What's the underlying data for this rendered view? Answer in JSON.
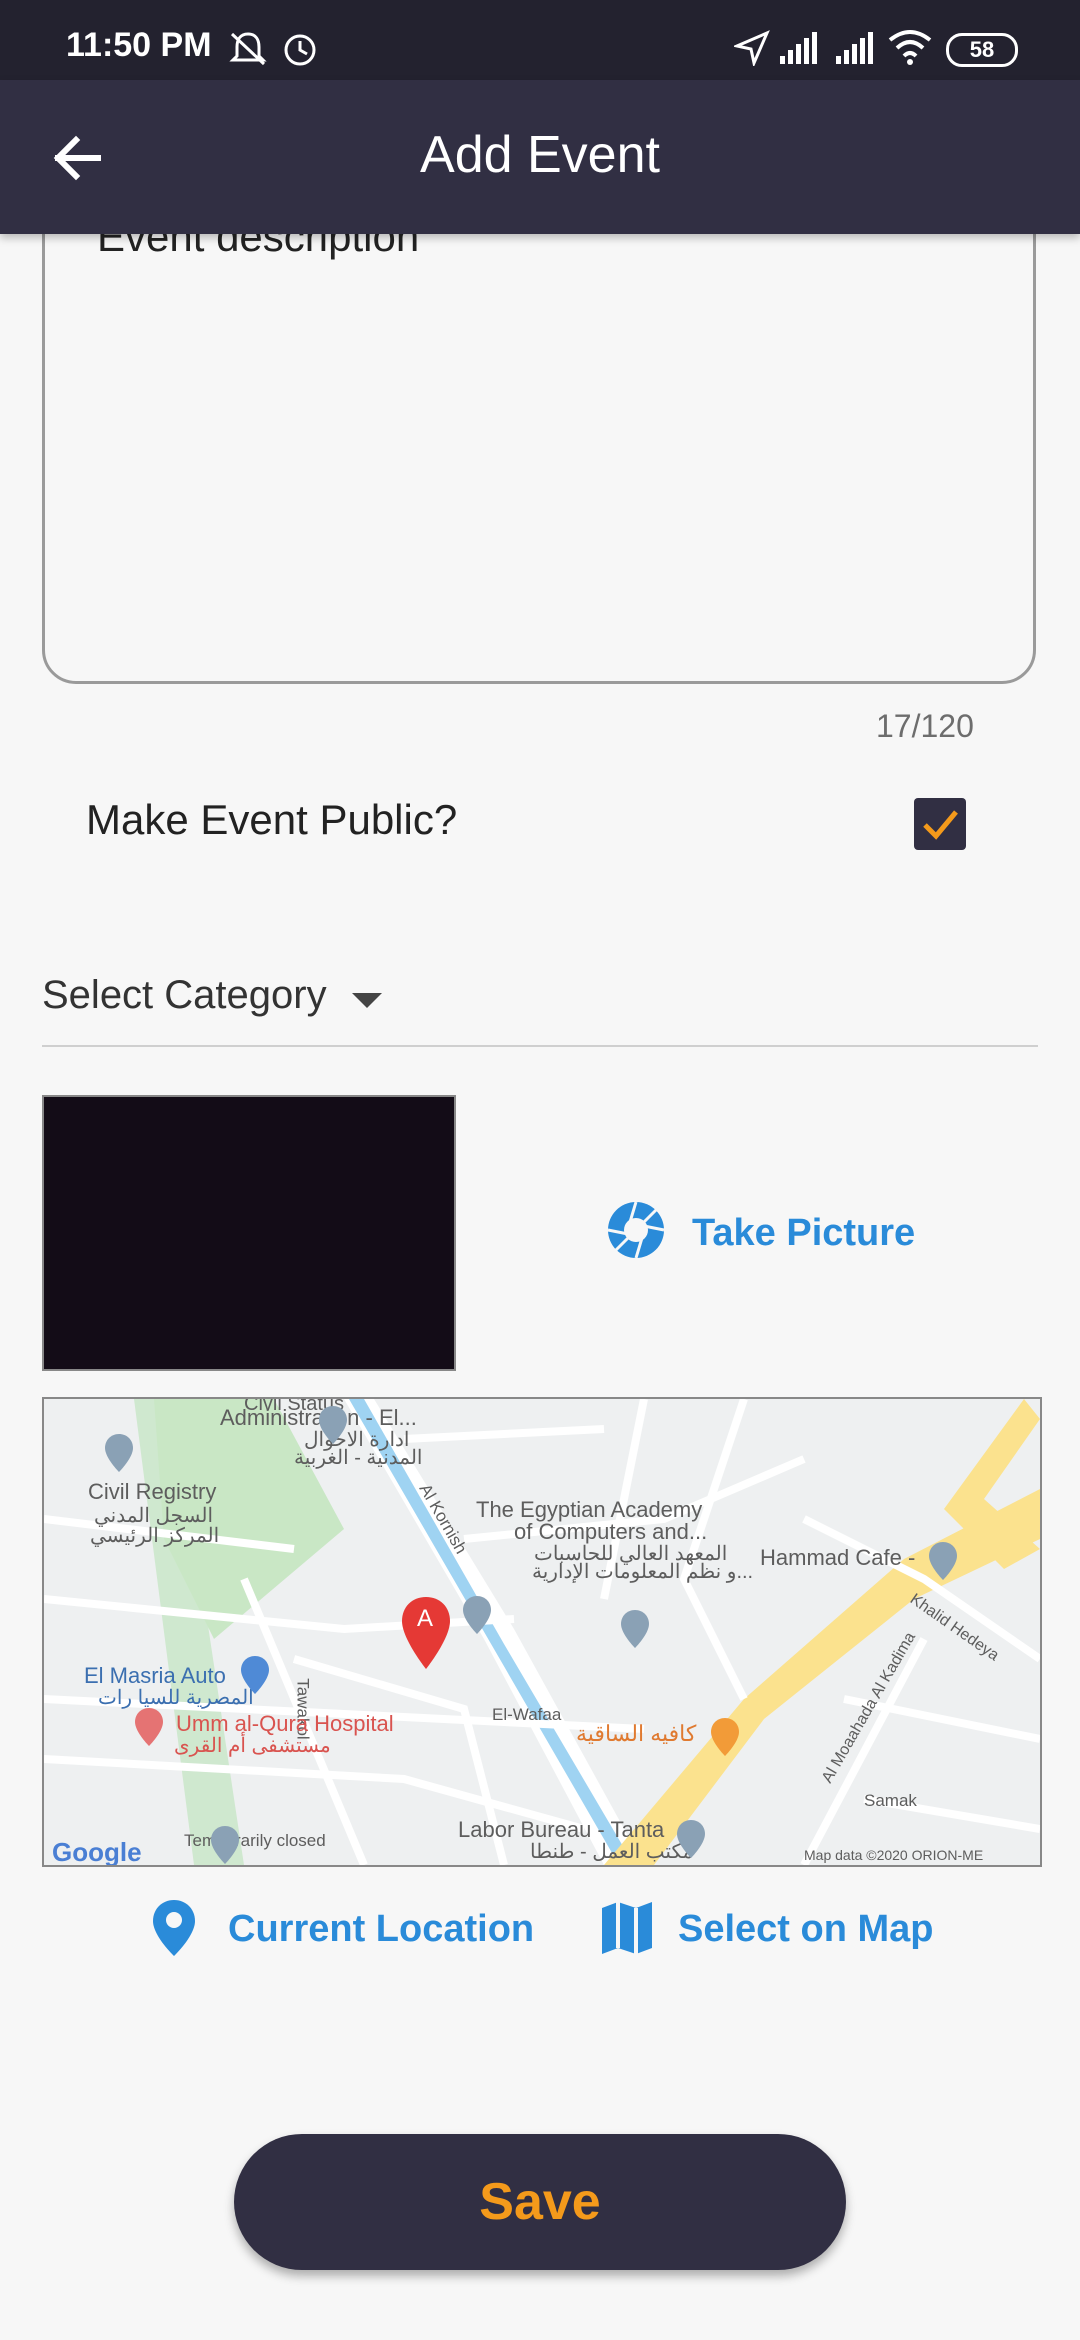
{
  "status_bar": {
    "time": "11:50 PM",
    "battery": "58",
    "icons": [
      "mute-icon",
      "alarm-icon",
      "location-arrow-icon",
      "signal-icon",
      "signal-icon",
      "wifi-icon"
    ]
  },
  "app_bar": {
    "title": "Add Event",
    "back_icon": "arrow-left-icon"
  },
  "form": {
    "description_value": "Event description",
    "counter": "17/120",
    "public_label": "Make Event Public?",
    "public_checked": true,
    "category_label": "Select Category",
    "take_picture_label": "Take Picture",
    "current_location_label": "Current Location",
    "select_on_map_label": "Select on Map",
    "save_label": "Save"
  },
  "map": {
    "marker_letter": "A",
    "labels": {
      "civil_status": "Civil Status",
      "administration": "Administration - El...",
      "admin_ar1": "ادارة الاحوال",
      "admin_ar2": "المدنية - الغربية",
      "civil_registry": "Civil Registry",
      "civil_ar1": "السجل المدني",
      "civil_ar2": "المركز الرئيسي",
      "academy1": "The Egyptian Academy",
      "academy2": "of Computers and...",
      "academy_ar1": "المعهد العالي للحاسبات",
      "academy_ar2": "و نظم المعلومات الإدارية...",
      "al_kornish": "Al Kornish",
      "hammad_cafe": "Hammad Cafe -",
      "el_masria_auto": "El Masria Auto",
      "el_masria_ar": "المصرية للسيا رات",
      "tawakol": "Tawakol",
      "umm_al_qura": "Umm al-Qura Hospital",
      "umm_al_qura_ar": "مستشفى أم القرى",
      "el_wafaa": "El-Wafaa",
      "cafe_ar": "كافيه الساقية",
      "al_moaahada": "Al Moaahada Al Kadima",
      "khalid_hedeya": "Khalid Hedeya",
      "samak": "Samak",
      "temporarily_closed": "Temporarily closed",
      "labor_bureau": "Labor Bureau - Tanta",
      "labor_ar": "مكتب العمل - طنطا",
      "google": "Google",
      "map_data": "Map data ©2020 ORION-ME"
    }
  },
  "colors": {
    "primary_dark": "#312f43",
    "accent_orange": "#f49a1b",
    "link_blue": "#2a8bd9",
    "background": "#f7f7f7"
  }
}
